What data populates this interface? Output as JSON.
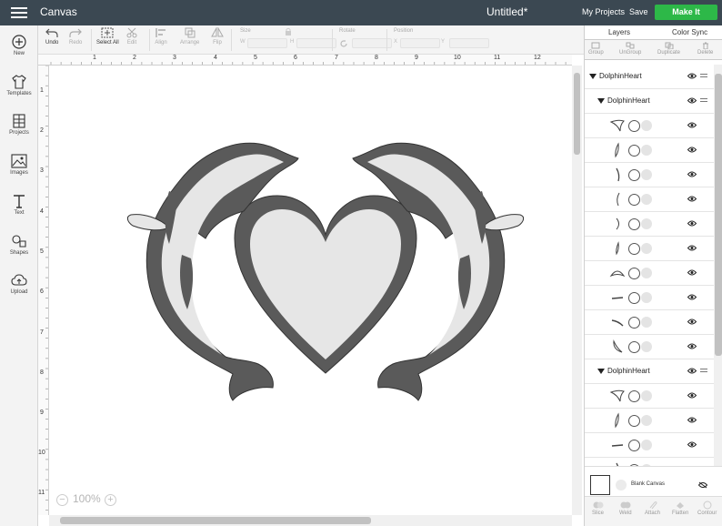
{
  "app": {
    "title": "Canvas",
    "document_title": "Untitled*"
  },
  "topbar": {
    "my_projects": "My Projects",
    "save": "Save",
    "make_it": "Make It",
    "make_it_color": "#2db848"
  },
  "sidebar": {
    "items": [
      {
        "label": "New",
        "icon": "plus-circle-icon"
      },
      {
        "label": "Templates",
        "icon": "tshirt-icon"
      },
      {
        "label": "Projects",
        "icon": "projects-icon"
      },
      {
        "label": "Images",
        "icon": "image-icon"
      },
      {
        "label": "Text",
        "icon": "text-icon"
      },
      {
        "label": "Shapes",
        "icon": "shapes-icon"
      },
      {
        "label": "Upload",
        "icon": "cloud-upload-icon"
      }
    ]
  },
  "toolbar": {
    "undo": "Undo",
    "redo": "Redo",
    "select_all": "Select All",
    "edit": "Edit",
    "align": "Align",
    "arrange": "Arrange",
    "flip": "Flip",
    "size": "Size",
    "size_w_prefix": "W",
    "size_h_prefix": "H",
    "rotate": "Rotate",
    "position": "Position",
    "pos_x_prefix": "X",
    "pos_y_prefix": "Y"
  },
  "ruler": {
    "top": [
      "1",
      "2",
      "3",
      "4",
      "5",
      "6",
      "7",
      "8",
      "9",
      "10",
      "11",
      "12"
    ],
    "left": [
      "1",
      "2",
      "3",
      "4",
      "5",
      "6",
      "7",
      "8",
      "9",
      "10",
      "11"
    ]
  },
  "zoom": {
    "level": "100%"
  },
  "panel": {
    "tabs": [
      "Layers",
      "Color Sync"
    ],
    "actions": [
      "Group",
      "UnGroup",
      "Duplicate",
      "Delete"
    ],
    "layers": [
      {
        "type": "group",
        "name": "DolphinHeart",
        "level": 0
      },
      {
        "type": "group",
        "name": "DolphinHeart",
        "level": 1
      },
      {
        "type": "shape",
        "shape": "fin"
      },
      {
        "type": "shape",
        "shape": "leaf"
      },
      {
        "type": "shape",
        "shape": "arc"
      },
      {
        "type": "shape",
        "shape": "hook"
      },
      {
        "type": "shape",
        "shape": "paren"
      },
      {
        "type": "shape",
        "shape": "tear"
      },
      {
        "type": "shape",
        "shape": "mound"
      },
      {
        "type": "shape",
        "shape": "dash"
      },
      {
        "type": "shape",
        "shape": "stroke"
      },
      {
        "type": "shape",
        "shape": "curl"
      },
      {
        "type": "group",
        "name": "DolphinHeart",
        "level": 1
      },
      {
        "type": "shape",
        "shape": "fin"
      },
      {
        "type": "shape",
        "shape": "leaf"
      },
      {
        "type": "shape",
        "shape": "dash"
      },
      {
        "type": "shape",
        "shape": "arc"
      }
    ],
    "blank_canvas": "Blank Canvas",
    "bottom_actions": [
      "Slice",
      "Weld",
      "Attach",
      "Flatten",
      "Contour"
    ]
  },
  "colors": {
    "topbar": "#3b4852",
    "design_dark": "#5a5a5a",
    "design_light": "#e6e6e6"
  }
}
